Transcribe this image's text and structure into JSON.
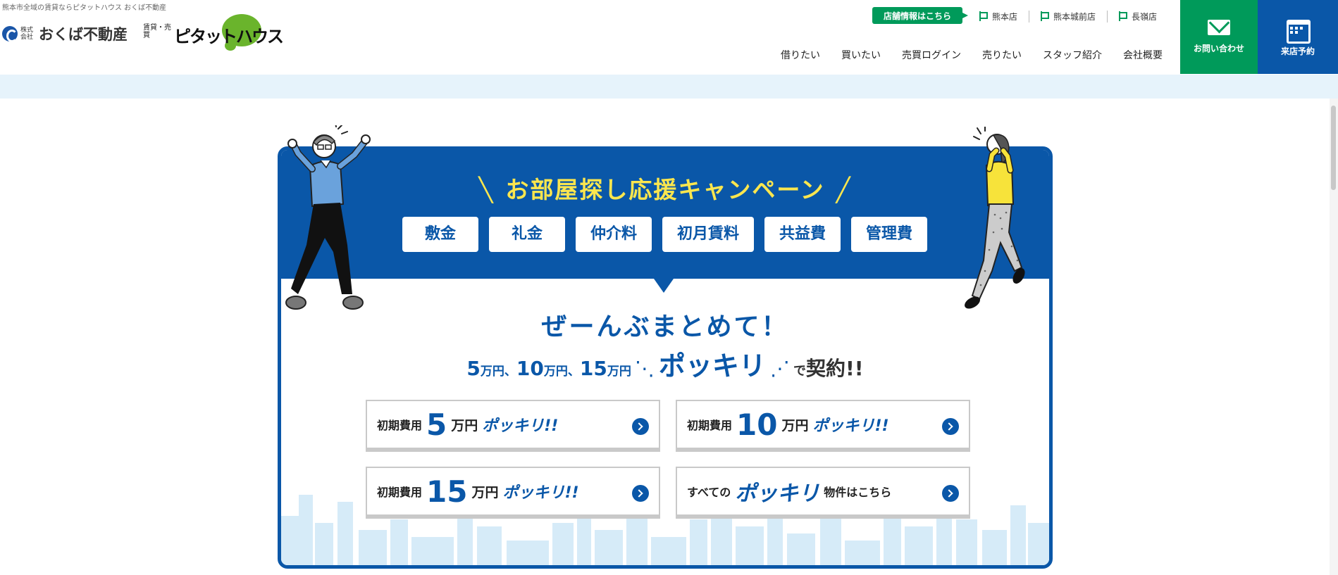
{
  "header": {
    "tagline": "熊本市全域の賃貸ならピタットハウス おくば不動産",
    "logo_company_sub": "株式会社",
    "logo_company_name": "おくば不動産",
    "logo_pitat_sub": "賃貸・売買",
    "logo_pitat_name": "ピタットハウス",
    "store_info_label": "店舗情報はこちら",
    "stores": [
      "熊本店",
      "熊本城前店",
      "長嶺店"
    ],
    "nav": [
      "借りたい",
      "買いたい",
      "売買ログイン",
      "売りたい",
      "スタッフ紹介",
      "会社概要"
    ],
    "contact_label": "お問い合わせ",
    "visit_label": "来店予約"
  },
  "campaign": {
    "title": "お部屋探し応援キャンペーン",
    "tags": [
      "敷金",
      "礼金",
      "仲介料",
      "初月賃料",
      "共益費",
      "管理費"
    ],
    "catch_main": "ぜーんぶまとめて！",
    "catch_sub": {
      "n1": "5",
      "n2": "10",
      "n3": "15",
      "unit": "万円",
      "sep": "、",
      "pokkiri": "ポッキリ",
      "de": "で",
      "keiyaku": "契約!!"
    },
    "links": [
      {
        "prefix": "初期費用",
        "amount": "5",
        "unit": "万円",
        "suffix": "ポッキリ!!"
      },
      {
        "prefix": "初期費用",
        "amount": "10",
        "unit": "万円",
        "suffix": "ポッキリ!!"
      },
      {
        "prefix": "初期費用",
        "amount": "15",
        "unit": "万円",
        "suffix": "ポッキリ!!"
      },
      {
        "prefix": "すべての",
        "amount": "ポッキリ",
        "unit": "物件はこちら",
        "suffix": ""
      }
    ]
  },
  "colors": {
    "brand_blue": "#0a57a8",
    "brand_green": "#009a5a",
    "title_yellow": "#fbe64e",
    "band_light_blue": "#e6f3fb"
  }
}
